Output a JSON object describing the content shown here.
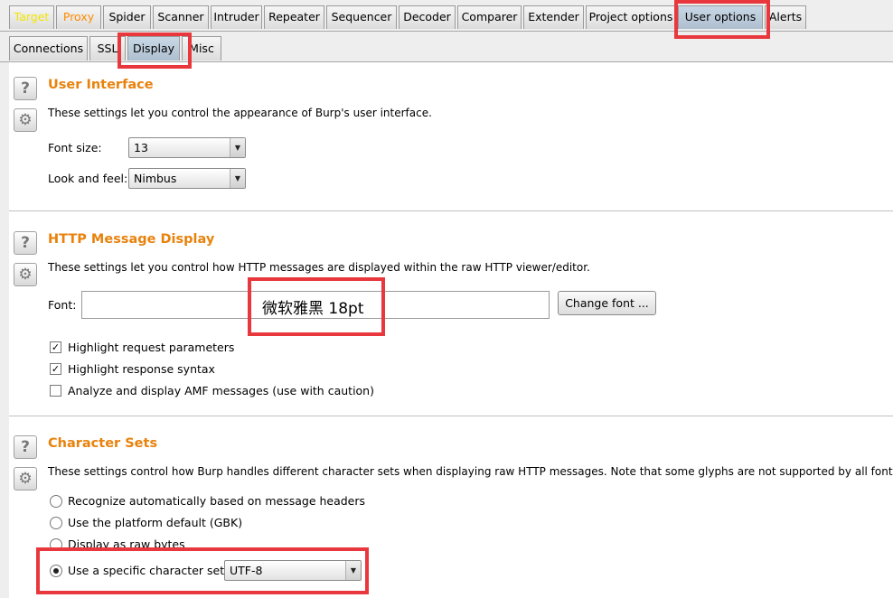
{
  "top_tabs": [
    "Target",
    "Proxy",
    "Spider",
    "Scanner",
    "Intruder",
    "Repeater",
    "Sequencer",
    "Decoder",
    "Comparer",
    "Extender",
    "Project options",
    "User options",
    "Alerts"
  ],
  "top_tab_selected": "User options",
  "sub_tabs": [
    "Connections",
    "SSL",
    "Display",
    "Misc"
  ],
  "sub_tab_selected": "Display",
  "icons": {
    "help": "help-icon",
    "settings": "gear-icon",
    "dropdown": "chevron-down-icon"
  },
  "colors": {
    "section_title": "#e8820c",
    "highlight_box": "#e8383d",
    "target_tab_text": "#f3e600",
    "proxy_tab_text": "#ff8c00"
  },
  "ui": {
    "title": "User Interface",
    "desc": "These settings let you control the appearance of Burp's user interface.",
    "font_size_label": "Font size:",
    "font_size_value": "13",
    "look_label": "Look and feel:",
    "look_value": "Nimbus"
  },
  "http": {
    "title": "HTTP Message Display",
    "desc": "These settings let you control how HTTP messages are displayed within the raw HTTP viewer/editor.",
    "font_label": "Font:",
    "font_value": "微软雅黑 18pt",
    "change_font_label": "Change font ...",
    "cb_request": "Highlight request parameters",
    "cb_response": "Highlight response syntax",
    "cb_amf": "Analyze and display AMF messages (use with caution)"
  },
  "charset": {
    "title": "Character Sets",
    "desc": "These settings control how Burp handles different character sets when displaying raw HTTP messages. Note that some glyphs are not supported by all fonts. If yo",
    "opt_auto": "Recognize automatically based on message headers",
    "opt_platform": "Use the platform default (GBK)",
    "opt_raw": "Display as raw bytes",
    "opt_specific": "Use a specific character set:",
    "specific_value": "UTF-8"
  }
}
